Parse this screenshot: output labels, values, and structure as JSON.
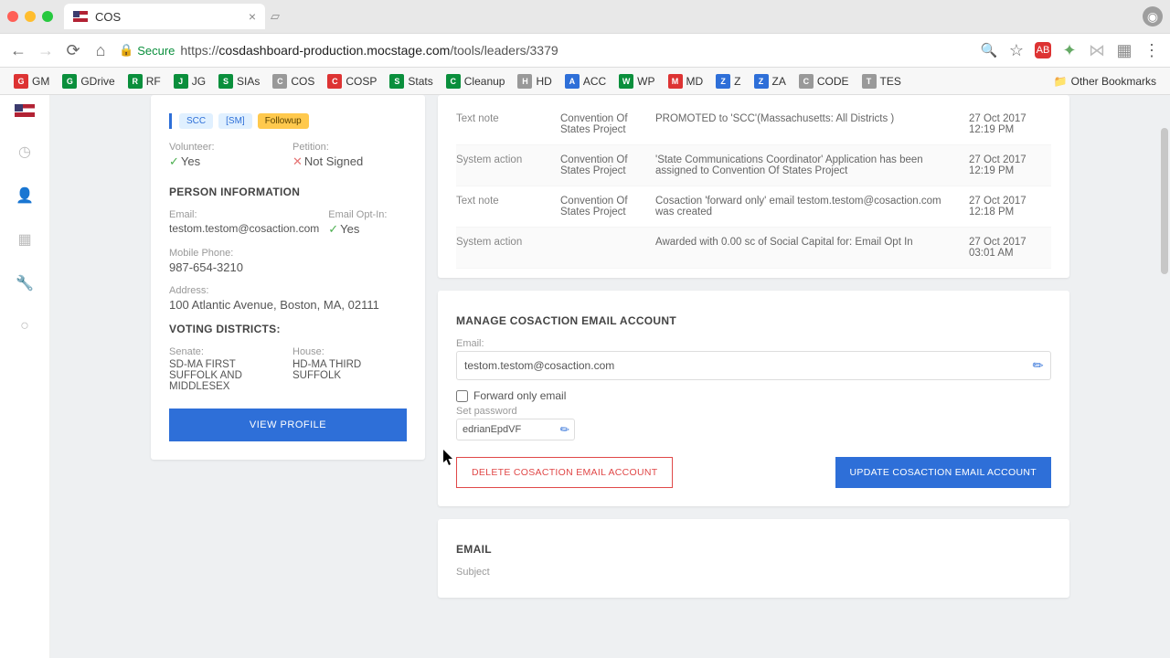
{
  "browser": {
    "tab_title": "COS",
    "secure_label": "Secure",
    "url_prefix": "https://",
    "url_domain": "cosdashboard-production.mocstage.com",
    "url_path": "/tools/leaders/3379"
  },
  "bookmarks": [
    {
      "label": "GM",
      "color": "#d33"
    },
    {
      "label": "GDrive",
      "color": "#0a8f3c"
    },
    {
      "label": "RF",
      "color": "#0a8f3c"
    },
    {
      "label": "JG",
      "color": "#0a8f3c"
    },
    {
      "label": "SIAs",
      "color": "#0a8f3c"
    },
    {
      "label": "COS",
      "color": "#999"
    },
    {
      "label": "COSP",
      "color": "#d33"
    },
    {
      "label": "Stats",
      "color": "#0a8f3c"
    },
    {
      "label": "Cleanup",
      "color": "#0a8f3c"
    },
    {
      "label": "HD",
      "color": "#999"
    },
    {
      "label": "ACC",
      "color": "#2e6fd8"
    },
    {
      "label": "WP",
      "color": "#0a8f3c"
    },
    {
      "label": "MD",
      "color": "#d33"
    },
    {
      "label": "Z",
      "color": "#2e6fd8"
    },
    {
      "label": "ZA",
      "color": "#2e6fd8"
    },
    {
      "label": "CODE",
      "color": "#999"
    },
    {
      "label": "TES",
      "color": "#999"
    }
  ],
  "other_bookmarks": "Other Bookmarks",
  "profile": {
    "badges": {
      "a": "SCC",
      "b": "[SM]",
      "c": "Followup"
    },
    "volunteer_label": "Volunteer:",
    "volunteer_value": "Yes",
    "petition_label": "Petition:",
    "petition_value": "Not Signed",
    "person_info_title": "PERSON INFORMATION",
    "email_label": "Email:",
    "email_value": "testom.testom@cosaction.com",
    "optin_label": "Email Opt-In:",
    "optin_value": "Yes",
    "mobile_label": "Mobile Phone:",
    "mobile_value": "987-654-3210",
    "address_label": "Address:",
    "address_value": "100 Atlantic Avenue, Boston, MA, 02111",
    "voting_title": "VOTING DISTRICTS:",
    "senate_label": "Senate:",
    "senate_value": "SD-MA FIRST SUFFOLK AND MIDDLESEX",
    "house_label": "House:",
    "house_value": "HD-MA THIRD SUFFOLK",
    "view_profile": "VIEW PROFILE"
  },
  "history": [
    {
      "type": "Text note",
      "org": "Convention Of States Project",
      "desc": "PROMOTED to 'SCC'(Massachusetts: All Districts )",
      "date": "27 Oct 2017",
      "time": "12:19 PM"
    },
    {
      "type": "System action",
      "org": "Convention Of States Project",
      "desc": "'State Communications Coordinator' Application has been assigned to Convention Of States Project",
      "date": "27 Oct 2017",
      "time": "12:19 PM"
    },
    {
      "type": "Text note",
      "org": "Convention Of States Project",
      "desc": "Cosaction 'forward only' email testom.testom@cosaction.com was created",
      "date": "27 Oct 2017",
      "time": "12:18 PM"
    },
    {
      "type": "System action",
      "org": "",
      "desc": "Awarded with 0.00 sc of Social Capital for: Email Opt In",
      "date": "27 Oct 2017",
      "time": "03:01 AM"
    }
  ],
  "manage": {
    "title": "MANAGE COSACTION EMAIL ACCOUNT",
    "email_label": "Email:",
    "email_value": "testom.testom@cosaction.com",
    "forward_label": "Forward only email",
    "setpw_label": "Set password",
    "password_value": "edrianEpdVF",
    "delete_btn": "DELETE COSACTION EMAIL ACCOUNT",
    "update_btn": "UPDATE COSACTION EMAIL ACCOUNT"
  },
  "email_section": {
    "title": "EMAIL",
    "subject_label": "Subject"
  }
}
